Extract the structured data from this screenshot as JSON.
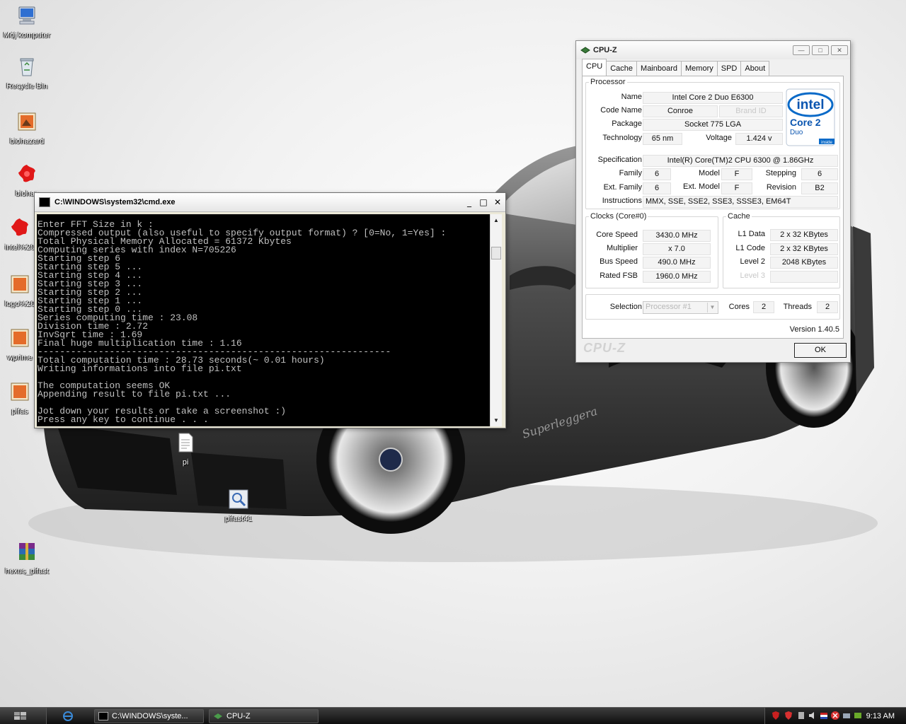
{
  "desktop": {
    "icons": [
      {
        "label": "Mój komputer",
        "icon": "computer-icon"
      },
      {
        "label": "Recycle Bin",
        "icon": "recycle-bin-icon"
      },
      {
        "label": "biohazard",
        "icon": "image-file-icon"
      },
      {
        "label": "biohaz",
        "icon": "biohazard-red-icon"
      },
      {
        "label": "intel%20",
        "icon": "biohazard-red-icon"
      },
      {
        "label": "logo%20",
        "icon": "image-file-icon"
      },
      {
        "label": "wprime",
        "icon": "image-file-icon"
      },
      {
        "label": "pifas",
        "icon": "image-file-icon"
      },
      {
        "label": "pi",
        "icon": "text-file-icon"
      },
      {
        "label": "pifast41",
        "icon": "program-icon"
      },
      {
        "label": "hexus_pifast",
        "icon": "winrar-icon"
      }
    ],
    "wallpaper_text": "Superleggera"
  },
  "cmd": {
    "title": "C:\\WINDOWS\\system32\\cmd.exe",
    "lines": [
      "Enter FFT Size in k :",
      "Compressed output (also useful to specify output format) ? [0=No, 1=Yes] :",
      "Total Physical Memory Allocated = 61372 Kbytes",
      "Computing series with index N=705226",
      "Starting step 6",
      "Starting step 5 ...",
      "Starting step 4 ...",
      "Starting step 3 ...",
      "Starting step 2 ...",
      "Starting step 1 ...",
      "Starting step 0 ...",
      "Series computing time : 23.08",
      "Division time : 2.72",
      "InvSqrt time : 1.69",
      "Final huge multiplication time : 1.16",
      "----------------------------------------------------------------",
      "Total computation time : 28.73 seconds(~ 0.01 hours)",
      "Writing informations into file pi.txt",
      "",
      "The computation seems OK",
      "Appending result to file pi.txt ...",
      "",
      "Jot down your results or take a screenshot :)",
      "Press any key to continue . . ."
    ]
  },
  "cpuz": {
    "title": "CPU-Z",
    "tabs": [
      "CPU",
      "Cache",
      "Mainboard",
      "Memory",
      "SPD",
      "About"
    ],
    "processor": {
      "legend": "Processor",
      "name_label": "Name",
      "name": "Intel Core 2 Duo E6300",
      "codename_label": "Code Name",
      "codename": "Conroe",
      "brandid_label": "Brand ID",
      "package_label": "Package",
      "package": "Socket 775 LGA",
      "technology_label": "Technology",
      "technology": "65 nm",
      "voltage_label": "Voltage",
      "voltage": "1.424 v",
      "spec_label": "Specification",
      "spec": "Intel(R) Core(TM)2 CPU          6300  @ 1.86GHz",
      "family_label": "Family",
      "family": "6",
      "model_label": "Model",
      "model": "F",
      "stepping_label": "Stepping",
      "stepping": "6",
      "extfamily_label": "Ext. Family",
      "extfamily": "6",
      "extmodel_label": "Ext. Model",
      "extmodel": "F",
      "revision_label": "Revision",
      "revision": "B2",
      "instructions_label": "Instructions",
      "instructions": "MMX, SSE, SSE2, SSE3, SSSE3, EM64T"
    },
    "logo": {
      "brand": "intel",
      "line1": "Core 2",
      "line2": "Duo",
      "line3": "inside"
    },
    "clocks": {
      "legend": "Clocks (Core#0)",
      "corespeed_label": "Core Speed",
      "corespeed": "3430.0 MHz",
      "multiplier_label": "Multiplier",
      "multiplier": "x 7.0",
      "busspeed_label": "Bus Speed",
      "busspeed": "490.0 MHz",
      "ratedfsb_label": "Rated FSB",
      "ratedfsb": "1960.0 MHz"
    },
    "cache": {
      "legend": "Cache",
      "l1data_label": "L1 Data",
      "l1data": "2 x 32 KBytes",
      "l1code_label": "L1 Code",
      "l1code": "2 x 32 KBytes",
      "level2_label": "Level 2",
      "level2": "2048 KBytes",
      "level3_label": "Level 3"
    },
    "selection_label": "Selection",
    "selection": "Processor #1",
    "cores_label": "Cores",
    "cores": "2",
    "threads_label": "Threads",
    "threads": "2",
    "version": "Version 1.40.5",
    "brand_watermark": "CPU-Z",
    "ok_label": "OK"
  },
  "taskbar": {
    "tasks": [
      {
        "label": "C:\\WINDOWS\\syste...",
        "icon": "console-icon"
      },
      {
        "label": "CPU-Z",
        "icon": "cpuz-icon"
      }
    ],
    "clock": "9:13 AM"
  }
}
